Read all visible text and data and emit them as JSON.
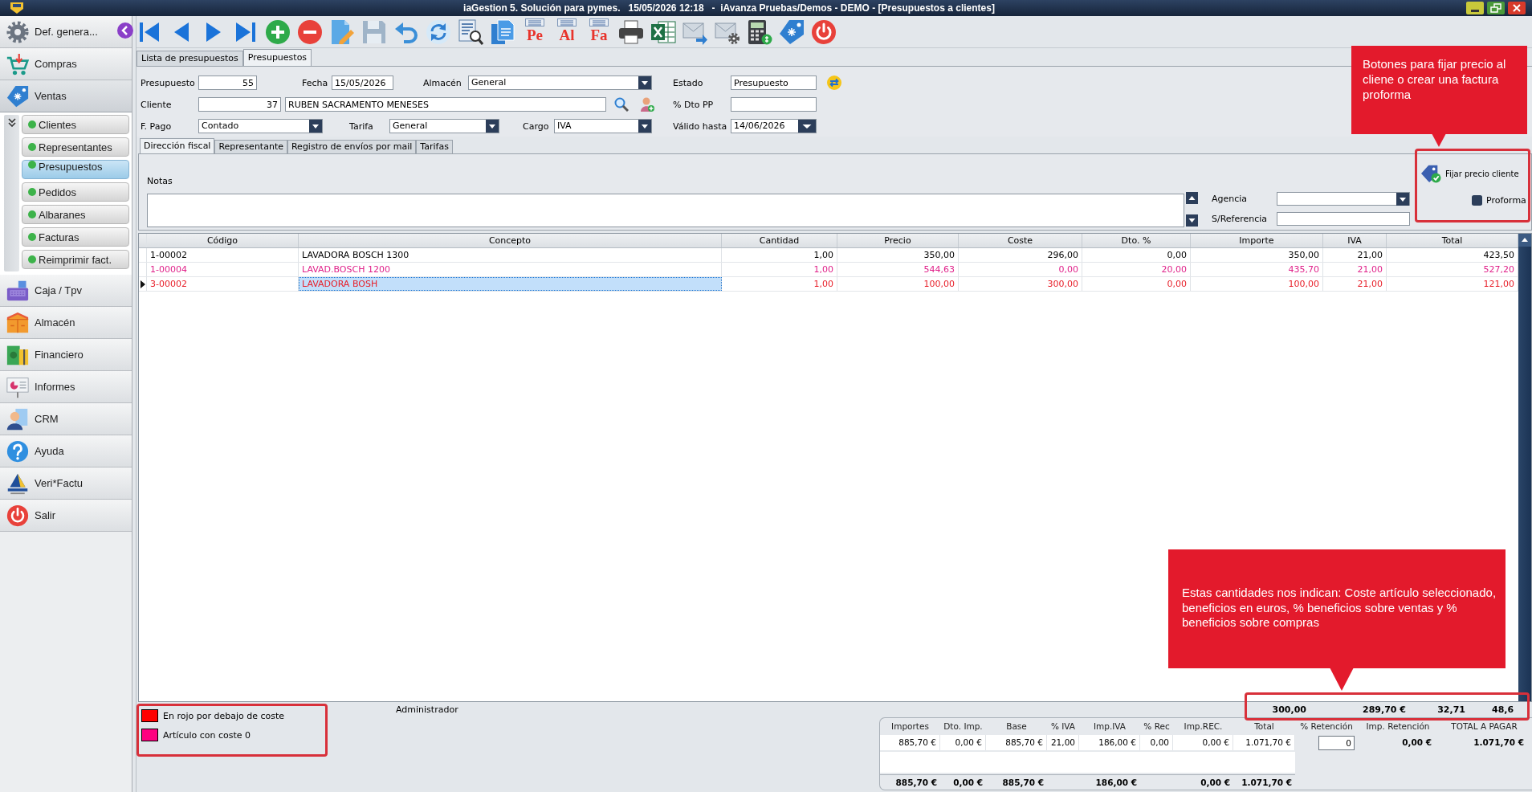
{
  "window": {
    "title": "iaGestion 5. Solución para pymes.   15/05/2026 12:18   -  iAvanza Pruebas/Demos - DEMO - [Presupuestos a clientes]"
  },
  "sidebar": {
    "items": [
      {
        "label": "Def. genera...",
        "expanded": false
      },
      {
        "label": "Compras",
        "expanded": false
      },
      {
        "label": "Ventas",
        "expanded": true,
        "children": [
          {
            "label": "Clientes",
            "selected": false
          },
          {
            "label": "Representantes",
            "selected": false
          },
          {
            "label": "Presupuestos",
            "selected": true
          },
          {
            "label": "Pedidos",
            "selected": false
          },
          {
            "label": "Albaranes",
            "selected": false
          },
          {
            "label": "Facturas",
            "selected": false
          },
          {
            "label": "Reimprimir fact.",
            "selected": false
          }
        ]
      },
      {
        "label": "Caja / Tpv",
        "expanded": false
      },
      {
        "label": "Almacén",
        "expanded": false
      },
      {
        "label": "Financiero",
        "expanded": false
      },
      {
        "label": "Informes",
        "expanded": false
      },
      {
        "label": "CRM",
        "expanded": false
      },
      {
        "label": "Ayuda",
        "expanded": false
      },
      {
        "label": "Veri*Factu",
        "expanded": false
      },
      {
        "label": "Salir",
        "expanded": false
      }
    ]
  },
  "toolbar": {
    "report_labels": [
      "Pe",
      "Al",
      "Fa"
    ]
  },
  "tabs": [
    {
      "label": "Lista de presupuestos",
      "selected": false
    },
    {
      "label": "Presupuestos",
      "selected": true
    }
  ],
  "form": {
    "rows": [
      [
        {
          "label": "Presupuesto",
          "value": "55",
          "kind": "number"
        },
        {
          "label": "Fecha",
          "value": "15/05/2026",
          "kind": "text"
        },
        {
          "label": "Almacén",
          "value": "General",
          "kind": "select"
        },
        {
          "label": "Estado",
          "value": "Presupuesto",
          "kind": "text"
        }
      ],
      [
        {
          "label": "Cliente",
          "value": "37",
          "kind": "number"
        },
        {
          "value": "RUBEN SACRAMENTO MENESES",
          "kind": "text"
        },
        "",
        {
          "label": "% Dto PP",
          "kind": "text"
        }
      ],
      [
        {
          "label": "F. Pago",
          "value": "Contado",
          "kind": "select"
        },
        {
          "label": "Tarifa",
          "value": "General",
          "kind": "select"
        },
        {
          "label": "Cargo",
          "value": "IVA",
          "kind": "select"
        },
        {
          "label": "Válido hasta",
          "value": "14/06/2026",
          "kind": "date"
        }
      ]
    ]
  },
  "subtabs": [
    {
      "label": "Dirección fiscal",
      "selected": true
    },
    {
      "label": "Representante",
      "selected": false
    },
    {
      "label": "Registro de envíos por mail",
      "selected": false
    },
    {
      "label": "Tarifas",
      "selected": false
    }
  ],
  "subpanel": {
    "notes_label": "Notas",
    "agency_label": "Agencia",
    "reference_label": "S/Referencia",
    "fix_price_button": "Fijar precio cliente",
    "proforma": {
      "label": "Proforma",
      "checked": false
    }
  },
  "grid": {
    "columns": [
      "Código",
      "Concepto",
      "Cantidad",
      "Precio",
      "Coste",
      "Dto. %",
      "Importe",
      "IVA",
      "Total"
    ],
    "rows": [
      {
        "selected": false,
        "color": "#000000",
        "cells": [
          {
            "text": "1-00002",
            "focused": false
          },
          {
            "text": "LAVADORA BOSCH 1300",
            "focused": false
          },
          {
            "text": "1,00",
            "focused": false
          },
          {
            "text": "350,00",
            "focused": false
          },
          {
            "text": "296,00",
            "focused": false
          },
          {
            "text": "0,00",
            "focused": false
          },
          {
            "text": "350,00",
            "focused": false
          },
          {
            "text": "21,00",
            "focused": false
          },
          {
            "text": "423,50",
            "focused": false
          }
        ]
      },
      {
        "selected": false,
        "color": "#e0218a",
        "cells": [
          {
            "text": "1-00004",
            "focused": false
          },
          {
            "text": "LAVAD.BOSCH 1200",
            "focused": false
          },
          {
            "text": "1,00",
            "focused": false
          },
          {
            "text": "544,63",
            "focused": false
          },
          {
            "text": "0,00",
            "focused": false
          },
          {
            "text": "20,00",
            "focused": false
          },
          {
            "text": "435,70",
            "focused": false
          },
          {
            "text": "21,00",
            "focused": false
          },
          {
            "text": "527,20",
            "focused": false
          }
        ]
      },
      {
        "selected": true,
        "color": "#e8202a",
        "cells": [
          {
            "text": "3-00002",
            "focused": false
          },
          {
            "text": "LAVADORA BOSH",
            "focused": true
          },
          {
            "text": "1,00",
            "focused": false
          },
          {
            "text": "100,00",
            "focused": false
          },
          {
            "text": "300,00",
            "focused": false
          },
          {
            "text": "0,00",
            "focused": false
          },
          {
            "text": "100,00",
            "focused": false
          },
          {
            "text": "21,00",
            "focused": false
          },
          {
            "text": "121,00",
            "focused": false
          }
        ]
      }
    ]
  },
  "legend": [
    {
      "label": "En rojo por debajo de coste",
      "color": "#ff0000"
    },
    {
      "label": "Artículo con coste 0",
      "color": "#ff0080"
    }
  ],
  "user": "Administrador",
  "stats": [
    "300,00",
    "289,70 €",
    "32,71",
    "48,6"
  ],
  "totals": {
    "headers": [
      "Importes",
      "Dto. Imp.",
      "Base",
      "% IVA",
      "Imp.IVA",
      "% Rec",
      "Imp.REC.",
      "Total",
      "% Retención",
      "Imp. Retención",
      "TOTAL A PAGAR"
    ],
    "values": [
      "885,70 €",
      "0,00 €",
      "885,70 €",
      "21,00",
      "186,00 €",
      "0,00",
      "0,00 €",
      "1.071,70 €"
    ],
    "retention": "0",
    "retention_amount": "0,00 €",
    "total_due": "1.071,70 €",
    "sums": [
      "885,70 €",
      "0,00 €",
      "885,70 €",
      "186,00 €",
      "0,00 €",
      "1.071,70 €"
    ]
  },
  "annotations": [
    {
      "text": "Botones para fijar precio al cliene o crear una factura proforma"
    },
    {
      "text": "Estas cantidades nos indican: Coste artículo seleccionado, beneficios en euros, % beneficios sobre ventas y % beneficios sobre compras"
    }
  ]
}
